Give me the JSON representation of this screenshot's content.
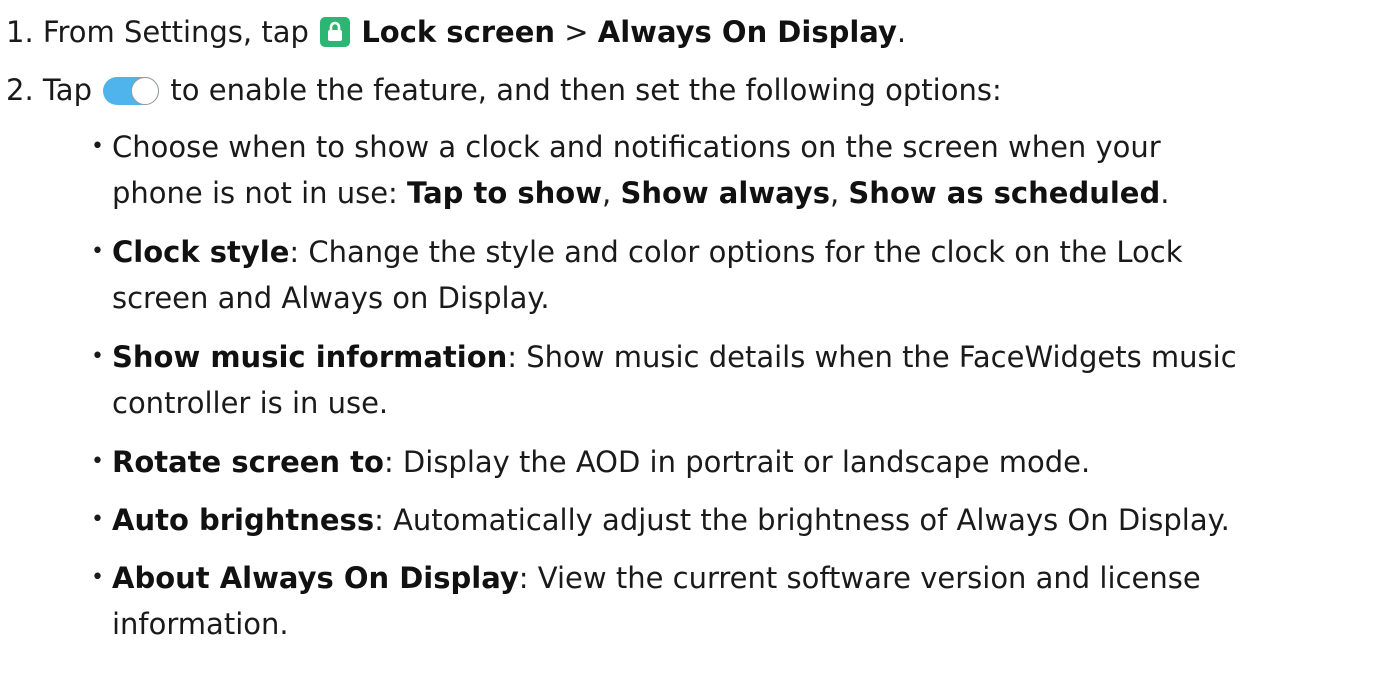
{
  "step1": {
    "number": "1.",
    "prefix": "From Settings, tap",
    "icon": "lock-icon",
    "lock_screen": "Lock screen",
    "chevron": ">",
    "aod": "Always On Display",
    "end": "."
  },
  "step2": {
    "number": "2.",
    "tap": "Tap",
    "icon": "toggle-switch-icon",
    "rest": "to enable the feature, and then set the following options:"
  },
  "bullets": [
    {
      "bold_lines": [],
      "line1": "Choose when to show a clock and notifications on the screen when your",
      "line2_prefix": "phone is not in use: ",
      "opt1": "Tap to show",
      "sep1": ", ",
      "opt2": "Show always",
      "sep2": ", ",
      "opt3": "Show as scheduled",
      "end": "."
    },
    {
      "term": "Clock style",
      "desc1": ": Change the style and color options for the clock on the Lock",
      "desc2": "screen and Always on Display."
    },
    {
      "term": "Show music information",
      "desc1": ": Show music details when the FaceWidgets music",
      "desc2": "controller is in use."
    },
    {
      "term": "Rotate screen to",
      "desc1": ": Display the AOD in portrait or landscape mode."
    },
    {
      "term": "Auto brightness",
      "desc1": ": Automatically adjust the brightness of Always On Display."
    },
    {
      "term": "About Always On Display",
      "desc1": ": View the current software version and license",
      "desc2": "information."
    }
  ],
  "bullet_char": "•",
  "colors": {
    "lock_icon_bg": "#2bb673",
    "toggle_bg": "#4fb4ec"
  }
}
